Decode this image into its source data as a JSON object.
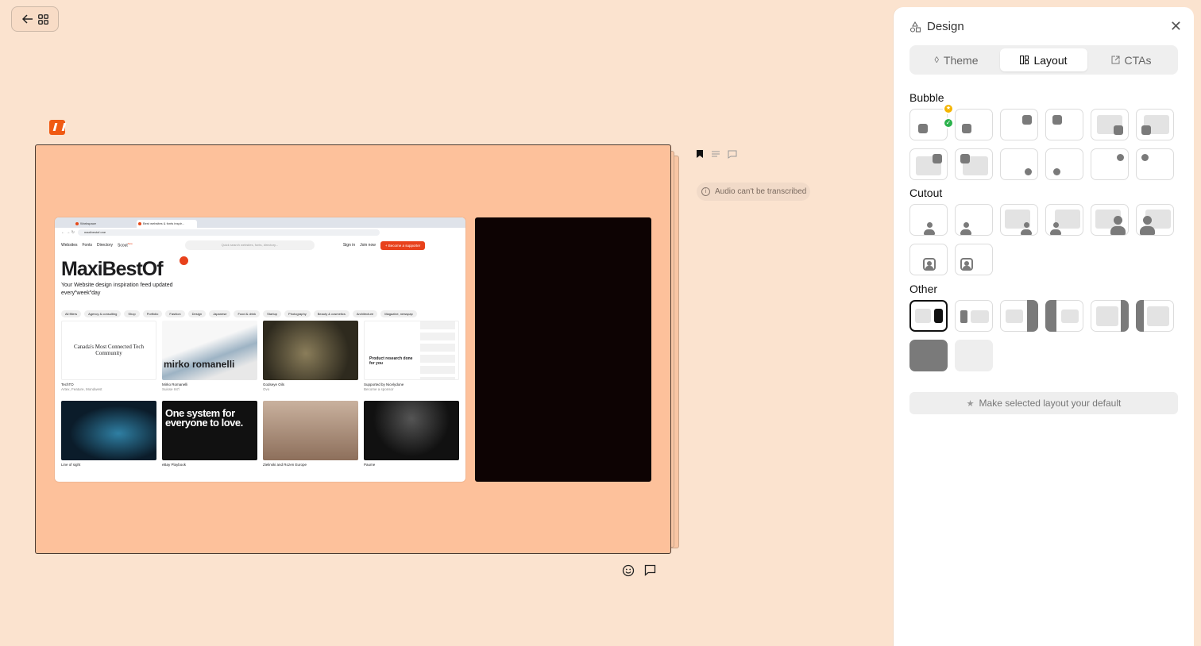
{
  "header": {
    "back_icon": "arrow-left-icon",
    "grid_icon": "grid-icon"
  },
  "browser": {
    "tabs": [
      "Workspace",
      "Best websites & fonts inspir..."
    ],
    "url": "maxibestof.one",
    "nav": [
      "Websites",
      "Fonts",
      "Directory",
      "Scout"
    ],
    "nav_badge": "New",
    "search_placeholder": "Quick search websites, fonts, directory...",
    "sign_in": "Sign in",
    "join_now": "Join now",
    "cta": "+ Become a supporter",
    "title": "MaxiBestOf",
    "tagline": "Your Website design inspiration feed updated every˟week˟day",
    "filters": [
      "All filters",
      "Agency & consulting",
      "Shop",
      "Portfolio",
      "Fashion",
      "Design",
      "Japanese",
      "Food & drink",
      "Startup",
      "Photography",
      "Beauty & cosmetics",
      "Architecture",
      "Magazine, newspap"
    ],
    "cards": [
      {
        "name": "TechTO",
        "sub": "Artex, Feature, Mondwest",
        "thumb_text": "Canada's Most Connected Tech Community",
        "color": "#ffffff"
      },
      {
        "name": "Mirko Romanelli",
        "sub": "Suisse Int'l",
        "thumb_text": "mirko romanelli",
        "color": "#f2f2f2"
      },
      {
        "name": "Godseye Oils",
        "sub": "Ovo",
        "thumb_text": "",
        "color": "#3c3a2a"
      },
      {
        "name": "Supported by Nicelydone",
        "sub": "Become a sponsor",
        "thumb_text": "Product research done for you",
        "color": "#ffffff"
      },
      {
        "name": "Line of sight",
        "sub": "",
        "thumb_text": "",
        "color": "#0e2436"
      },
      {
        "name": "eBay Playbook",
        "sub": "",
        "thumb_text": "One system for everyone to love.",
        "color": "#111111"
      },
      {
        "name": "Zielinski and Rozen Europe",
        "sub": "",
        "thumb_text": "",
        "color": "#b79a84"
      },
      {
        "name": "Paume",
        "sub": "",
        "thumb_text": "",
        "color": "#1a1a1a"
      }
    ]
  },
  "side": {
    "icons": [
      "bookmark-icon",
      "transcript-icon",
      "comment-icon"
    ],
    "notice": "Audio can't be transcribed"
  },
  "bottom": {
    "icons": [
      "emoji-icon",
      "comment-icon"
    ]
  },
  "panel": {
    "title": "Design",
    "tabs": [
      {
        "label": "Theme",
        "icon": "droplet-icon",
        "active": false
      },
      {
        "label": "Layout",
        "icon": "layout-icon",
        "active": true
      },
      {
        "label": "CTAs",
        "icon": "external-link-icon",
        "active": false
      }
    ],
    "sections": {
      "bubble": "Bubble",
      "cutout": "Cutout",
      "other": "Other"
    },
    "default_button": "Make selected layout your default"
  },
  "colors": {
    "background": "#fbe3cf",
    "canvas": "#fdc19b",
    "accent": "#e8411b",
    "selected": "#111111"
  }
}
